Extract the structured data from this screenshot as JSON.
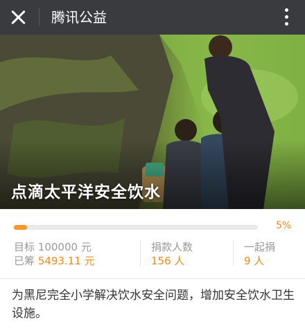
{
  "header": {
    "title": "腾讯公益",
    "close_icon": "close-icon",
    "menu_icon": "more-vertical-icon"
  },
  "hero": {
    "title": "点滴太平洋安全饮水"
  },
  "progress": {
    "percent_label": "5%",
    "fraction": 0.055
  },
  "stats": {
    "target_label": "目标",
    "target_value": "100000 元",
    "raised_label": "已筹",
    "raised_value": "5493.11 元",
    "donors_label": "捐款人数",
    "donors_value": "156 人",
    "together_label": "一起捐",
    "together_value": "9 人"
  },
  "description": "为黑尼完全小学解决饮水安全问题，增加安全饮水卫生设施。",
  "colors": {
    "header_bg": "#3a3b3f",
    "accent": "#f08a1b"
  }
}
